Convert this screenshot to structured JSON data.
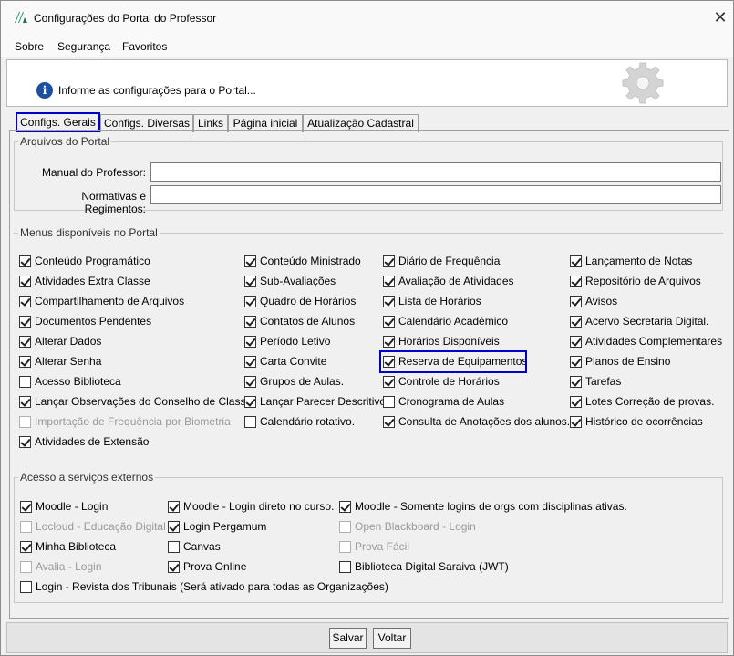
{
  "window": {
    "title": "Configurações do Portal do Professor",
    "close": "✕"
  },
  "menu": {
    "items": [
      "Sobre",
      "Segurança",
      "Favoritos"
    ]
  },
  "header": {
    "info_text": "Informe as configurações para o Portal..."
  },
  "tabs": [
    "Configs. Gerais",
    "Configs. Diversas",
    "Links",
    "Página inicial",
    "Atualização Cadastral"
  ],
  "arquivos": {
    "title": "Arquivos do Portal",
    "manual_label": "Manual do Professor:",
    "manual_value": "",
    "normativas_label": "Normativas e Regimentos:",
    "normativas_value": ""
  },
  "menus": {
    "title": "Menus disponíveis no Portal",
    "items": [
      {
        "label": "Conteúdo Programático",
        "checked": true,
        "enabled": true
      },
      {
        "label": "Conteúdo Ministrado",
        "checked": true,
        "enabled": true
      },
      {
        "label": "Diário de Frequência",
        "checked": true,
        "enabled": true
      },
      {
        "label": "Lançamento de Notas",
        "checked": true,
        "enabled": true
      },
      {
        "label": "Atividades Extra Classe",
        "checked": true,
        "enabled": true
      },
      {
        "label": "Sub-Avaliações",
        "checked": true,
        "enabled": true
      },
      {
        "label": "Avaliação de Atividades",
        "checked": true,
        "enabled": true
      },
      {
        "label": "Repositório de Arquivos",
        "checked": true,
        "enabled": true
      },
      {
        "label": "Compartilhamento de Arquivos",
        "checked": true,
        "enabled": true
      },
      {
        "label": "Quadro de Horários",
        "checked": true,
        "enabled": true
      },
      {
        "label": "Lista de Horários",
        "checked": true,
        "enabled": true
      },
      {
        "label": "Avisos",
        "checked": true,
        "enabled": true
      },
      {
        "label": "Documentos Pendentes",
        "checked": true,
        "enabled": true
      },
      {
        "label": "Contatos de Alunos",
        "checked": true,
        "enabled": true
      },
      {
        "label": "Calendário Acadêmico",
        "checked": true,
        "enabled": true
      },
      {
        "label": "Acervo Secretaria Digital.",
        "checked": true,
        "enabled": true
      },
      {
        "label": "Alterar Dados",
        "checked": true,
        "enabled": true
      },
      {
        "label": "Período Letivo",
        "checked": true,
        "enabled": true
      },
      {
        "label": "Horários Disponíveis",
        "checked": true,
        "enabled": true
      },
      {
        "label": "Atividades Complementares",
        "checked": true,
        "enabled": true
      },
      {
        "label": "Alterar Senha",
        "checked": true,
        "enabled": true
      },
      {
        "label": "Carta Convite",
        "checked": true,
        "enabled": true
      },
      {
        "label": "Reserva de Equipamentos",
        "checked": true,
        "enabled": true
      },
      {
        "label": "Planos de Ensino",
        "checked": true,
        "enabled": true
      },
      {
        "label": "Acesso Biblioteca",
        "checked": false,
        "enabled": true
      },
      {
        "label": "Grupos de Aulas.",
        "checked": true,
        "enabled": true
      },
      {
        "label": "Controle de Horários",
        "checked": true,
        "enabled": true
      },
      {
        "label": "Tarefas",
        "checked": true,
        "enabled": true
      },
      {
        "label": "Lançar Observações do Conselho de Classe",
        "checked": true,
        "enabled": true
      },
      {
        "label": "Lançar Parecer Descritivo",
        "checked": true,
        "enabled": true
      },
      {
        "label": "Cronograma de Aulas",
        "checked": false,
        "enabled": true
      },
      {
        "label": "Lotes Correção de provas.",
        "checked": true,
        "enabled": true
      },
      {
        "label": "Importação de Frequência por Biometria",
        "checked": false,
        "enabled": false
      },
      {
        "label": "Calendário rotativo.",
        "checked": false,
        "enabled": true
      },
      {
        "label": "Consulta de Anotações dos alunos.",
        "checked": true,
        "enabled": true
      },
      {
        "label": "Histórico de ocorrências",
        "checked": true,
        "enabled": true
      },
      {
        "label": "Atividades de Extensão",
        "checked": true,
        "enabled": true
      }
    ]
  },
  "externos": {
    "title": "Acesso a serviços externos",
    "items": [
      {
        "label": "Moodle - Login",
        "checked": true,
        "enabled": true
      },
      {
        "label": "Moodle - Login direto no curso.",
        "checked": true,
        "enabled": true
      },
      {
        "label": "Moodle - Somente logins de orgs com disciplinas ativas.",
        "checked": true,
        "enabled": true
      },
      {
        "label": "Locloud - Educação Digital",
        "checked": false,
        "enabled": false
      },
      {
        "label": "Login Pergamum",
        "checked": true,
        "enabled": true
      },
      {
        "label": "Open Blackboard - Login",
        "checked": false,
        "enabled": false
      },
      {
        "label": "Minha Biblioteca",
        "checked": true,
        "enabled": true
      },
      {
        "label": "Canvas",
        "checked": false,
        "enabled": true
      },
      {
        "label": "Prova Fácil",
        "checked": false,
        "enabled": false
      },
      {
        "label": "Avalia - Login",
        "checked": false,
        "enabled": false
      },
      {
        "label": "Prova Online",
        "checked": true,
        "enabled": true
      },
      {
        "label": "Biblioteca Digital Saraiva (JWT)",
        "checked": false,
        "enabled": true
      },
      {
        "label": "Login - Revista dos Tribunais (Será ativado para todas as Organizações)",
        "checked": false,
        "enabled": true
      }
    ]
  },
  "buttons": {
    "save": "Salvar",
    "back": "Voltar"
  }
}
